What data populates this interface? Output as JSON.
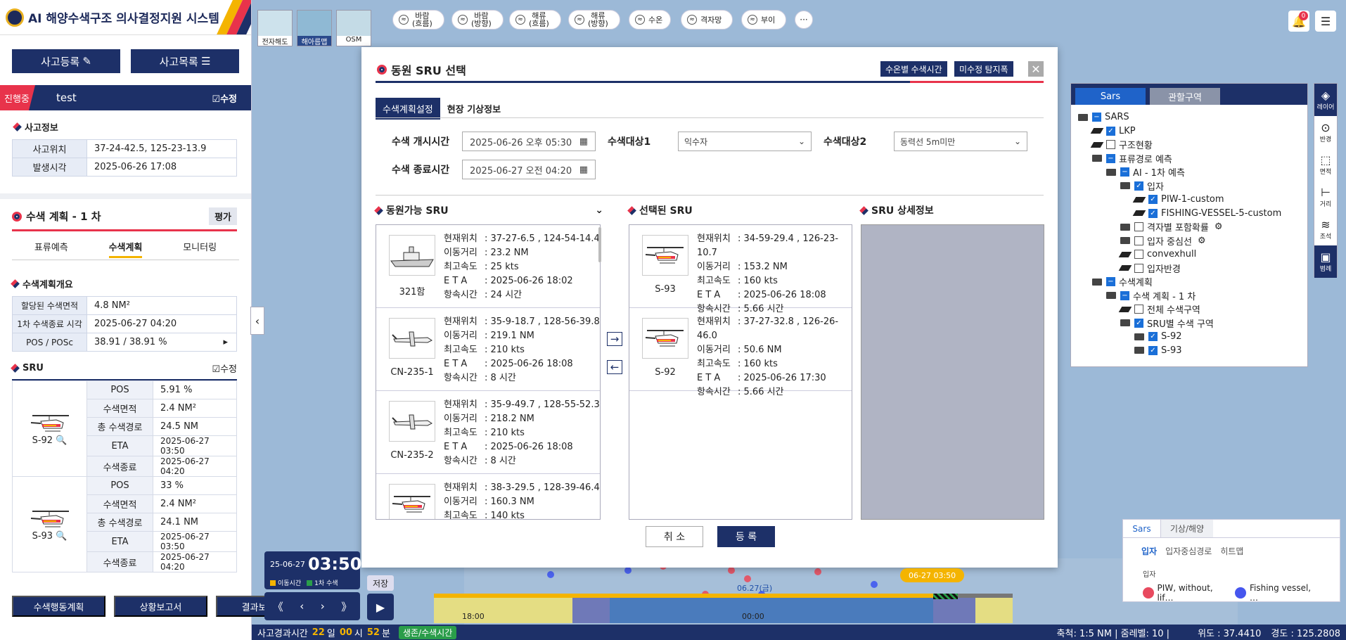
{
  "app": {
    "title": "AI 해양수색구조 의사결정지원 시스템"
  },
  "sidebar": {
    "register_button": "사고등록",
    "list_button": "사고목록",
    "status_badge": "진행중",
    "incident_name": "test",
    "edit_label": "수정",
    "incident_info_title": "사고정보",
    "incident_info": [
      {
        "label": "사고위치",
        "value": "37-24-42.5, 125-23-13.9"
      },
      {
        "label": "발생시각",
        "value": "2025-06-26 17:08"
      }
    ],
    "plan_title": "수색 계획 - 1 차",
    "eval_button": "평가",
    "plan_tabs": [
      "표류예측",
      "수색계획",
      "모니터링"
    ],
    "plan_overview_title": "수색계획개요",
    "plan_overview": [
      {
        "label": "할당된 수색면적",
        "value": "4.8 NM²"
      },
      {
        "label": "1차 수색종료 시각",
        "value": "2025-06-27 04:20"
      },
      {
        "label": "POS / POSc",
        "value": "38.91 / 38.91 %"
      }
    ],
    "sru_title": "SRU",
    "sru_edit": "수정",
    "srus": [
      {
        "name": "S-92",
        "rows": [
          {
            "label": "POS",
            "value": "5.91 %"
          },
          {
            "label": "수색면적",
            "value": "2.4 NM²"
          },
          {
            "label": "총 수색경로",
            "value": "24.5 NM"
          },
          {
            "label": "ETA",
            "value": "2025-06-27 03:50"
          },
          {
            "label": "수색종료",
            "value": "2025-06-27 04:20"
          }
        ]
      },
      {
        "name": "S-93",
        "rows": [
          {
            "label": "POS",
            "value": "33 %"
          },
          {
            "label": "수색면적",
            "value": "2.4 NM²"
          },
          {
            "label": "총 수색경로",
            "value": "24.1 NM"
          },
          {
            "label": "ETA",
            "value": "2025-06-27 03:50"
          },
          {
            "label": "수색종료",
            "value": "2025-06-27 04:20"
          }
        ]
      }
    ],
    "bottom_buttons": [
      "수색행동계획",
      "상황보고서",
      "결과보고서"
    ]
  },
  "toolbar": {
    "basemaps": [
      "전자해도",
      "해아름맵",
      "OSM"
    ],
    "layers": [
      {
        "l1": "바람",
        "l2": "(흐름)"
      },
      {
        "l1": "바람",
        "l2": "(방향)"
      },
      {
        "l1": "해류",
        "l2": "(흐름)"
      },
      {
        "l1": "해류",
        "l2": "(방향)"
      },
      {
        "l1": "수온",
        "l2": ""
      },
      {
        "l1": "격자망",
        "l2": ""
      },
      {
        "l1": "부이",
        "l2": ""
      }
    ],
    "more": "···",
    "notification_count": "0"
  },
  "modal": {
    "title": "동원 SRU 선택",
    "btn_water_time": "수온별 수색시간",
    "btn_sweep": "미수정 탐지폭",
    "close": "✕",
    "tabs": [
      "수색계획설정",
      "현장 기상정보"
    ],
    "start_label": "수색 개시시간",
    "start_value": "2025-06-26 오후 05:30",
    "end_label": "수색 종료시간",
    "end_value": "2025-06-27 오전 04:20",
    "target1_label": "수색대상1",
    "target1_value": "익수자",
    "target2_label": "수색대상2",
    "target2_value": "동력선 5m미만",
    "available_title": "동원가능 SRU",
    "selected_title": "선택된 SRU",
    "detail_title": "SRU 상세정보",
    "field_labels": [
      "현재위치",
      "이동거리",
      "최고속도",
      "E T A",
      "항속시간"
    ],
    "available": [
      {
        "name": "321함",
        "kind": "ship",
        "pos": "37-27-6.5 , 124-54-14.4",
        "dist": "23.2 NM",
        "speed": "25 kts",
        "eta": "2025-06-26 18:02",
        "endurance": "24 시간"
      },
      {
        "name": "CN-235-1",
        "kind": "plane",
        "pos": "35-9-18.7 , 128-56-39.8",
        "dist": "219.1 NM",
        "speed": "210 kts",
        "eta": "2025-06-26 18:08",
        "endurance": "8 시간"
      },
      {
        "name": "CN-235-2",
        "kind": "plane",
        "pos": "35-9-49.7 , 128-55-52.3",
        "dist": "218.2 NM",
        "speed": "210 kts",
        "eta": "2025-06-26 18:08",
        "endurance": "8 시간"
      },
      {
        "name": "",
        "kind": "heli",
        "pos": "38-3-29.5 , 128-39-46.4",
        "dist": "160.3 NM",
        "speed": "140 kts",
        "eta": "",
        "endurance": ""
      }
    ],
    "selected": [
      {
        "name": "S-93",
        "kind": "heli",
        "pos": "34-59-29.4 , 126-23-10.7",
        "dist": "153.2 NM",
        "speed": "160 kts",
        "eta": "2025-06-26 18:08",
        "endurance": "5.66 시간"
      },
      {
        "name": "S-92",
        "kind": "heli",
        "pos": "37-27-32.8 , 126-26-46.0",
        "dist": "50.6 NM",
        "speed": "160 kts",
        "eta": "2025-06-26 17:30",
        "endurance": "5.66 시간"
      }
    ],
    "cancel": "취 소",
    "register": "등 록"
  },
  "layer_panel": {
    "tabs": [
      "Sars",
      "관할구역"
    ],
    "tree": [
      {
        "level": 0,
        "icon": "folder",
        "check": "minus",
        "label": "SARS"
      },
      {
        "level": 1,
        "icon": "layer",
        "check": "on",
        "label": "LKP"
      },
      {
        "level": 1,
        "icon": "layer",
        "check": "off",
        "label": "구조현황"
      },
      {
        "level": 1,
        "icon": "folder",
        "check": "minus",
        "label": "표류경로 예측"
      },
      {
        "level": 2,
        "icon": "folder",
        "check": "minus",
        "label": "AI - 1차 예측"
      },
      {
        "level": 3,
        "icon": "folder",
        "check": "on",
        "label": "입자"
      },
      {
        "level": 4,
        "icon": "layer",
        "check": "on",
        "label": "PIW-1-custom"
      },
      {
        "level": 4,
        "icon": "layer",
        "check": "on",
        "label": "FISHING-VESSEL-5-custom"
      },
      {
        "level": 3,
        "icon": "folder",
        "check": "off",
        "label": "격자별 포함확률",
        "gear": true
      },
      {
        "level": 3,
        "icon": "folder",
        "check": "off",
        "label": "입자 중심선",
        "gear": true
      },
      {
        "level": 3,
        "icon": "layer",
        "check": "off",
        "label": "convexhull"
      },
      {
        "level": 3,
        "icon": "layer",
        "check": "off",
        "label": "입자반경"
      },
      {
        "level": 1,
        "icon": "folder",
        "check": "minus",
        "label": "수색계획"
      },
      {
        "level": 2,
        "icon": "folder",
        "check": "minus",
        "label": "수색 계획 - 1 차"
      },
      {
        "level": 3,
        "icon": "layer",
        "check": "off",
        "label": "전체 수색구역"
      },
      {
        "level": 3,
        "icon": "folder",
        "check": "on",
        "label": "SRU별 수색 구역"
      },
      {
        "level": 4,
        "icon": "folder",
        "check": "on",
        "label": "S-92"
      },
      {
        "level": 4,
        "icon": "folder",
        "check": "on",
        "label": "S-93"
      }
    ]
  },
  "right_tools": [
    "레이어",
    "반경",
    "면적",
    "거리",
    "조석",
    "범례"
  ],
  "legend": {
    "tabs": [
      "Sars",
      "기상/해양"
    ],
    "subtabs": [
      "입자",
      "입자중심경로",
      "히트맵"
    ],
    "section": "입자",
    "items": [
      {
        "label": "PIW, without, lif…",
        "color": "#e84a5f"
      },
      {
        "label": "Fishing vessel, …",
        "color": "#4656ee"
      }
    ]
  },
  "timeline": {
    "date": "25-06-27",
    "time": "03:50",
    "legend_move": "이동시간",
    "legend_search": "1차 수색",
    "save": "저장",
    "current_badge": "06-27 03:50",
    "day_label": "06.27(금)",
    "tick1": "18:00",
    "tick2": "00:00",
    "controls": [
      "《",
      "‹",
      "›",
      "》"
    ]
  },
  "status_bar": {
    "elapsed_label": "사고경과시간",
    "days": "22",
    "day_unit": "일",
    "hours": "00",
    "hour_unit": "시",
    "mins": "52",
    "min_unit": "분",
    "survival_badge": "생존/수색시간",
    "scale": "축척: 1:5 NM | 줌레벨: 10 |",
    "lat": "위도 : 37.4410",
    "lon": "경도 : 125.2808"
  },
  "colors": {
    "navy": "#1d3068",
    "red": "#e8334b",
    "accent": "#f4b400"
  }
}
